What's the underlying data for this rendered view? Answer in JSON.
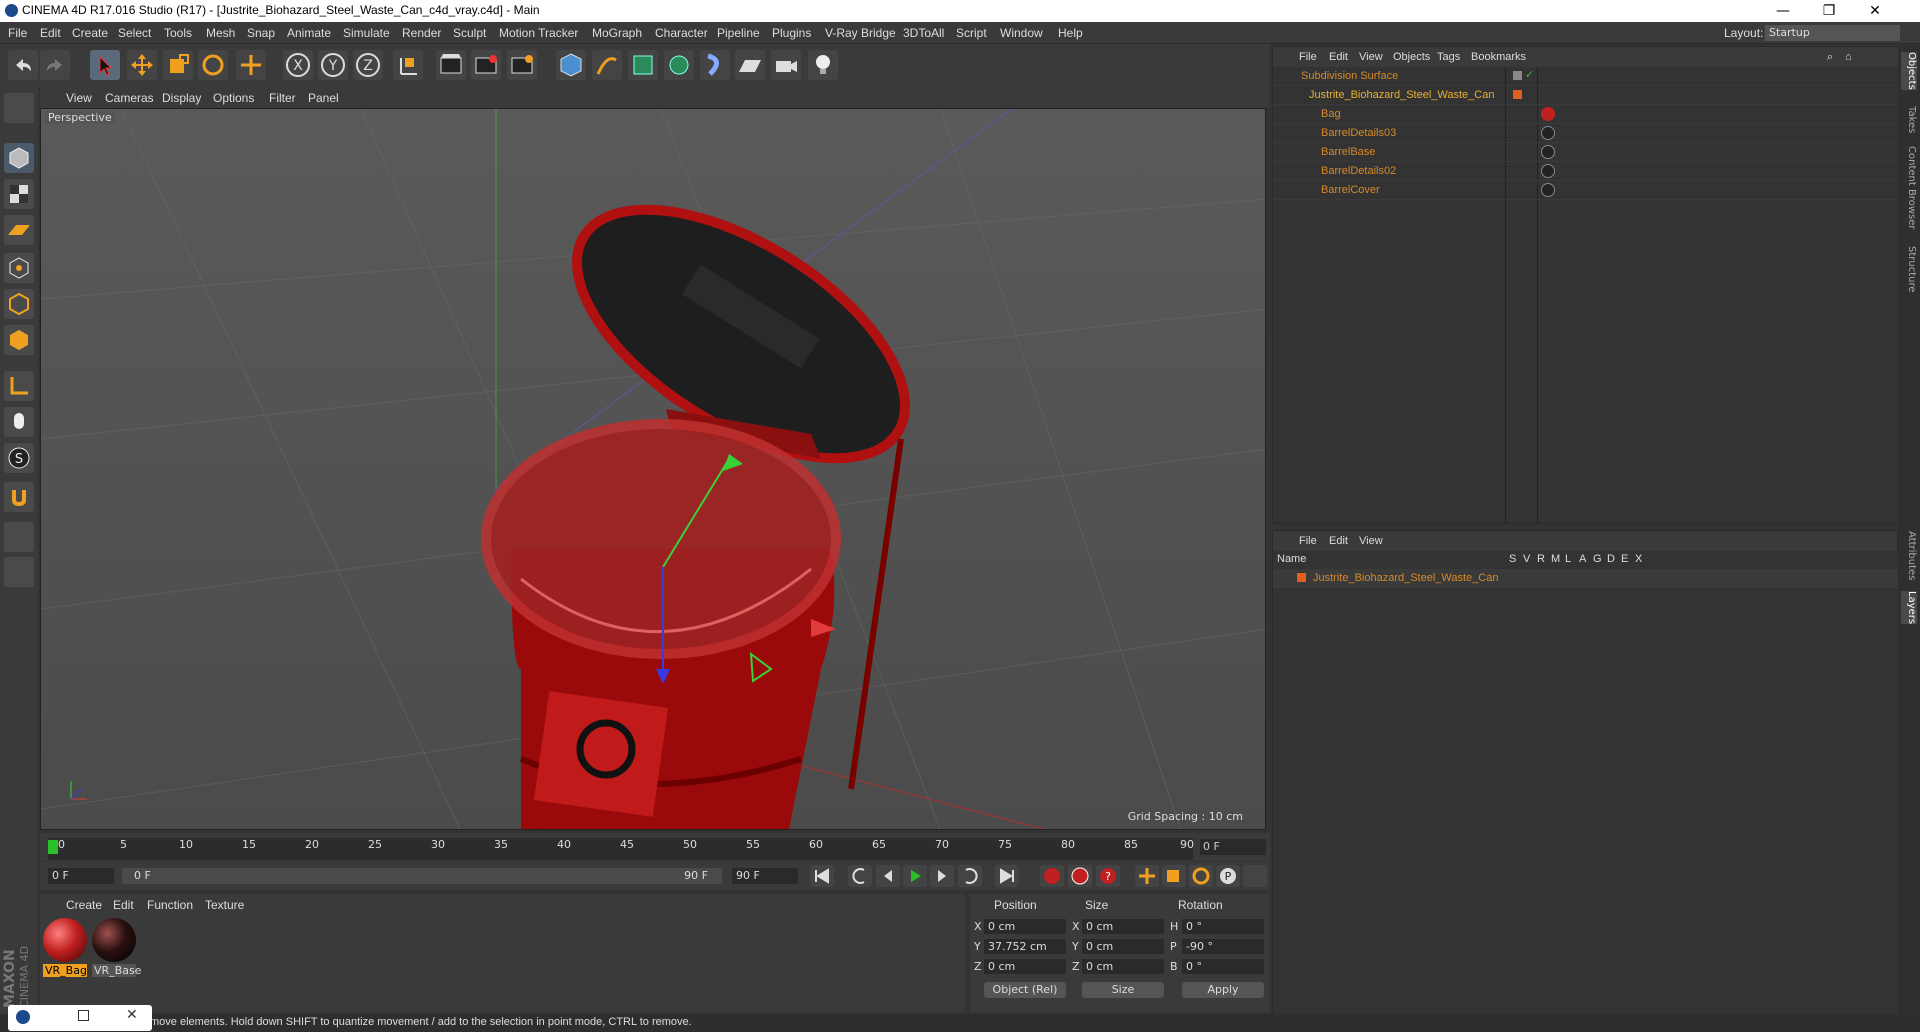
{
  "window": {
    "title": "CINEMA 4D R17.016 Studio (R17) - [Justrite_Biohazard_Steel_Waste_Can_c4d_vray.c4d] - Main",
    "min": "—",
    "max": "❐",
    "close": "✕"
  },
  "menubar": {
    "items": [
      "File",
      "Edit",
      "Create",
      "Select",
      "Tools",
      "Mesh",
      "Snap",
      "Animate",
      "Simulate",
      "Render",
      "Sculpt",
      "Motion Tracker",
      "MoGraph",
      "Character",
      "Pipeline",
      "Plugins",
      "V-Ray Bridge",
      "3DToAll",
      "Script",
      "Window",
      "Help"
    ],
    "layout_label": "Layout:",
    "layout_value": "Startup"
  },
  "viewport": {
    "menu": [
      "View",
      "Cameras",
      "Display",
      "Options",
      "Filter",
      "Panel"
    ],
    "label": "Perspective",
    "grid_spacing": "Grid Spacing : 10 cm"
  },
  "timeline": {
    "ticks": [
      "0",
      "5",
      "10",
      "15",
      "20",
      "25",
      "30",
      "35",
      "40",
      "45",
      "50",
      "55",
      "60",
      "65",
      "70",
      "75",
      "80",
      "85",
      "90"
    ],
    "frame": "0 F",
    "start": "0 F",
    "range_start": "0 F",
    "range_end": "90 F",
    "end": "90 F"
  },
  "material_manager": {
    "menu": [
      "Create",
      "Edit",
      "Function",
      "Texture"
    ],
    "materials": [
      {
        "name": "VR_Bag",
        "color": "#c02020"
      },
      {
        "name": "VR_Base",
        "color": "#2a1010"
      }
    ]
  },
  "coordinates": {
    "headers": [
      "Position",
      "Size",
      "Rotation"
    ],
    "rows": [
      {
        "axis": "X",
        "pos": "0 cm",
        "saxis": "X",
        "size": "0 cm",
        "raxis": "H",
        "rot": "0 °"
      },
      {
        "axis": "Y",
        "pos": "37.752 cm",
        "saxis": "Y",
        "size": "0 cm",
        "raxis": "P",
        "rot": "-90 °"
      },
      {
        "axis": "Z",
        "pos": "0 cm",
        "saxis": "Z",
        "size": "0 cm",
        "raxis": "B",
        "rot": "0 °"
      }
    ],
    "mode": "Object (Rel)",
    "size_mode": "Size",
    "apply": "Apply"
  },
  "object_manager": {
    "menu": [
      "File",
      "Edit",
      "View",
      "Objects",
      "Tags",
      "Bookmarks"
    ],
    "objects": [
      {
        "name": "Subdivision Surface",
        "color": "#d58a2a"
      },
      {
        "name": "Justrite_Biohazard_Steel_Waste_Can",
        "color": "#e8b030"
      },
      {
        "name": "Bag",
        "color": "#d58a2a"
      },
      {
        "name": "BarrelDetails03",
        "color": "#d58a2a"
      },
      {
        "name": "BarrelBase",
        "color": "#d58a2a"
      },
      {
        "name": "BarrelDetails02",
        "color": "#d58a2a"
      },
      {
        "name": "BarrelCover",
        "color": "#d58a2a"
      }
    ]
  },
  "layer_manager": {
    "menu": [
      "File",
      "Edit",
      "View"
    ],
    "col_name": "Name",
    "cols": [
      "S",
      "V",
      "R",
      "M",
      "L",
      "A",
      "G",
      "D",
      "E",
      "X"
    ],
    "layers": [
      {
        "name": "Justrite_Biohazard_Steel_Waste_Can"
      }
    ]
  },
  "side_tabs": [
    "Objects",
    "Takes",
    "Content Browser",
    "Structure",
    "Attributes",
    "Layers"
  ],
  "status": {
    "text": "move elements. Hold down SHIFT to quantize movement / add to the selection in point mode, CTRL to remove."
  },
  "brand": {
    "maxon": "MAXON",
    "c4d": "CINEMA 4D"
  },
  "colors": {
    "accent": "#e8b030",
    "object": "#d58a2a",
    "panel": "#3a3a3a"
  }
}
